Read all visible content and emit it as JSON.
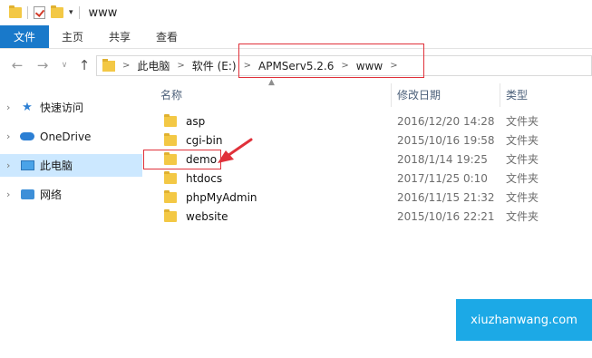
{
  "title_bar": {
    "window_title": "www",
    "quick_access_icons": [
      "folder-icon",
      "properties-check-icon",
      "new-folder-icon",
      "customize-dropdown-icon"
    ]
  },
  "ribbon": {
    "tabs": [
      {
        "label": "文件"
      },
      {
        "label": "主页"
      },
      {
        "label": "共享"
      },
      {
        "label": "查看"
      }
    ],
    "file_tab_color": "#1979ca"
  },
  "navigation": {
    "back_icon": "arrow-left-icon",
    "forward_icon": "arrow-right-icon",
    "recent_icon": "chevron-down-icon",
    "up_icon": "arrow-up-icon",
    "breadcrumb": [
      "此电脑",
      "软件 (E:)",
      "APMServ5.2.6",
      "www"
    ]
  },
  "sidebar": {
    "items": [
      {
        "label": "快速访问",
        "icon": "star-icon"
      },
      {
        "label": "OneDrive",
        "icon": "cloud-icon"
      },
      {
        "label": "此电脑",
        "icon": "computer-icon",
        "selected": true
      },
      {
        "label": "网络",
        "icon": "network-icon"
      }
    ],
    "selected_color": "#cce8ff"
  },
  "columns": {
    "name": "名称",
    "modified": "修改日期",
    "type": "类型"
  },
  "files": [
    {
      "name": "asp",
      "modified": "2016/12/20 14:28",
      "type": "文件夹"
    },
    {
      "name": "cgi-bin",
      "modified": "2015/10/16 19:58",
      "type": "文件夹"
    },
    {
      "name": "demo",
      "modified": "2018/1/14 19:25",
      "type": "文件夹"
    },
    {
      "name": "htdocs",
      "modified": "2017/11/25 0:10",
      "type": "文件夹"
    },
    {
      "name": "phpMyAdmin",
      "modified": "2016/11/15 21:32",
      "type": "文件夹"
    },
    {
      "name": "website",
      "modified": "2015/10/16 22:21",
      "type": "文件夹"
    }
  ],
  "annotation_color": "#e0313a",
  "watermark": {
    "text": "xiuzhanwang.com",
    "color": "#1ca9e6"
  }
}
